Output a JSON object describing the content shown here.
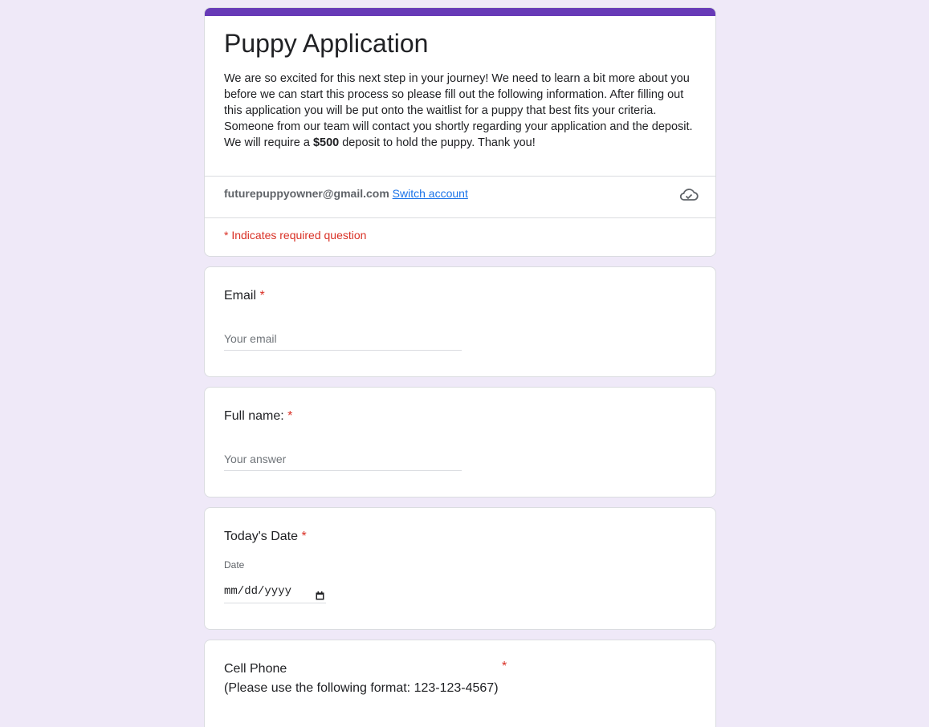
{
  "form": {
    "title": "Puppy Application",
    "description_part1": "We are so excited for this next step in your journey! We need to learn a bit more about you before we can start this process so please fill out the following information. After filling out this application you will be put onto the waitlist for a puppy that best fits your criteria. Someone from our team will contact you shortly regarding your application and the deposit. We will require a ",
    "description_bold": "$500",
    "description_part2": " deposit to hold the puppy. Thank you!",
    "account_email": "futurepuppyowner@gmail.com",
    "switch_account_label": "Switch account",
    "required_note": "* Indicates required question",
    "accent_color": "#673ab7",
    "background_color": "#efe9f8"
  },
  "questions": {
    "email": {
      "label": "Email",
      "required_mark": "*",
      "placeholder": "Your email"
    },
    "full_name": {
      "label": "Full name:",
      "required_mark": "*",
      "placeholder": "Your answer"
    },
    "todays_date": {
      "label": "Today's Date",
      "required_mark": "*",
      "sub_label": "Date",
      "value_placeholder": "mm/dd/yyyy"
    },
    "cell_phone": {
      "label_line1": "Cell Phone",
      "label_line2": "(Please use the following format: 123-123-4567)",
      "required_mark": "*"
    }
  },
  "icons": {
    "saved_status": "cloud-check-icon",
    "date_picker": "calendar-icon"
  }
}
